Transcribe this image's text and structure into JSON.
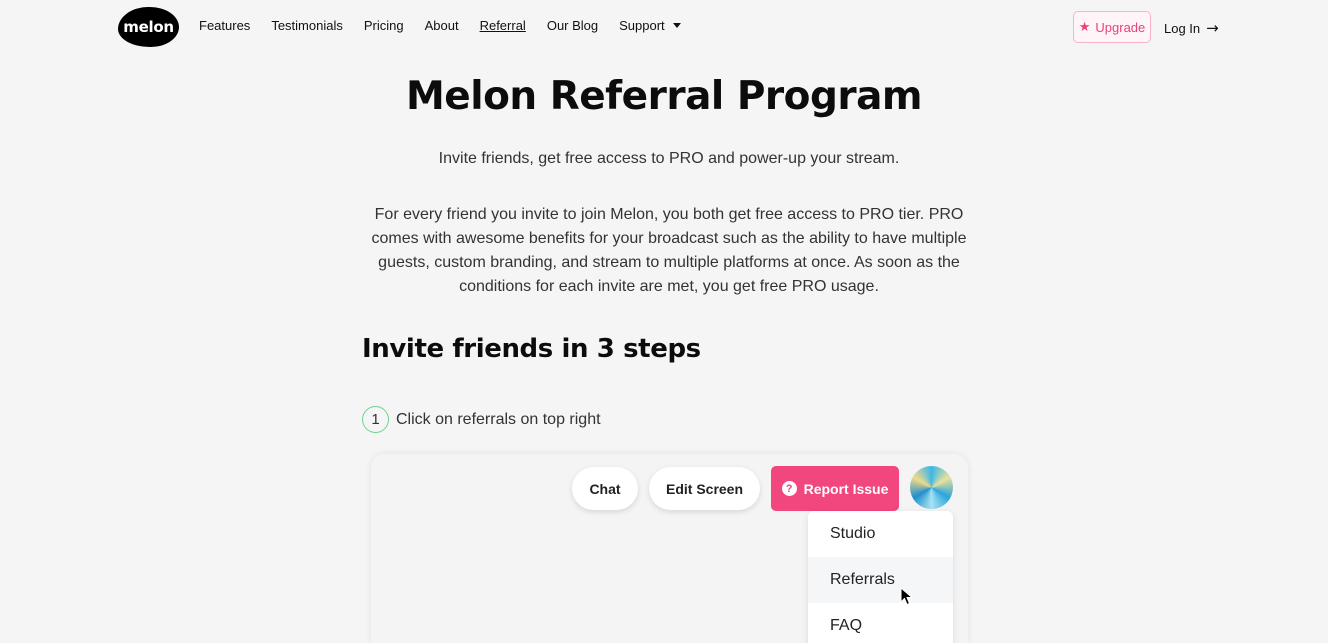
{
  "nav": {
    "logo": "melon",
    "links": [
      "Features",
      "Testimonials",
      "Pricing",
      "About",
      "Referral",
      "Our Blog"
    ],
    "support": "Support",
    "upgrade": "Upgrade",
    "login": "Log In",
    "active_link": "Referral",
    "accent_color": "#e8427c"
  },
  "main": {
    "title": "Melon Referral Program",
    "subtitle": "Invite friends, get free access to PRO and power-up your stream.",
    "description": "For every friend you invite to join Melon, you both get free access to PRO tier. PRO comes with awesome benefits for your broadcast such as the ability to have multiple guests, custom branding, and stream to multiple platforms at once. As soon as the conditions for each invite are met, you get free PRO usage.",
    "steps_heading": "Invite friends in 3 steps",
    "step1": {
      "number": "1",
      "text": "Click on referrals on top right"
    }
  },
  "screenshot": {
    "chat": "Chat",
    "edit_screen": "Edit Screen",
    "report_issue": "Report Issue",
    "menu": [
      "Studio",
      "Referrals",
      "FAQ"
    ],
    "hovered_item": "Referrals",
    "report_color": "#f2467f"
  }
}
